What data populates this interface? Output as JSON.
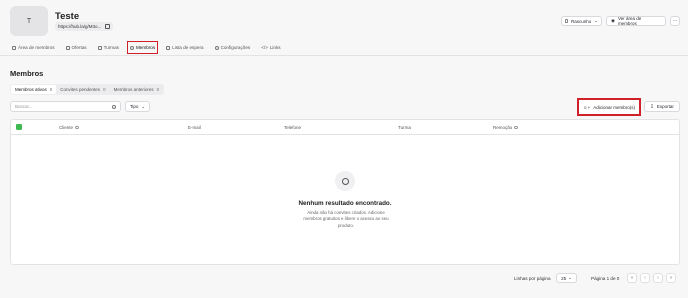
{
  "header": {
    "avatar_letter": "T",
    "title": "Teste",
    "url": "https://hub.la/g/M3o...",
    "status_label": "Rascunho",
    "view_members_label": "Ver área de membros",
    "more_label": "···"
  },
  "nav": {
    "tabs": [
      {
        "label": "Área de membros"
      },
      {
        "label": "Ofertas"
      },
      {
        "label": "Turmas"
      },
      {
        "label": "Membros"
      },
      {
        "label": "Lista de espera"
      },
      {
        "label": "Configurações"
      },
      {
        "label": "Links"
      }
    ],
    "active": "Membros"
  },
  "section": {
    "title": "Membros",
    "subtabs": [
      {
        "label": "Membros ativos",
        "count": "0"
      },
      {
        "label": "Convites pendentes",
        "count": "0"
      },
      {
        "label": "Membros anteriores",
        "count": "0"
      }
    ]
  },
  "toolbar": {
    "search_placeholder": "Buscar...",
    "type_label": "Tipo",
    "add_label": "Adicionar membro(s)",
    "export_label": "Exportar"
  },
  "table": {
    "columns": [
      "Cliente",
      "E-mail",
      "Telefone",
      "Turma",
      "Remoção"
    ],
    "empty_title": "Nenhum resultado encontrado.",
    "empty_desc": "Ainda não há convites criados. Adicione membros gratuitos e libere o acesso ao seu produto."
  },
  "pagination": {
    "rows_label": "Linhas por página",
    "rows_value": "25",
    "page_info": "Página 1 de 0"
  },
  "colors": {
    "highlight": "#d0202a",
    "checkbox": "#3fb950"
  }
}
